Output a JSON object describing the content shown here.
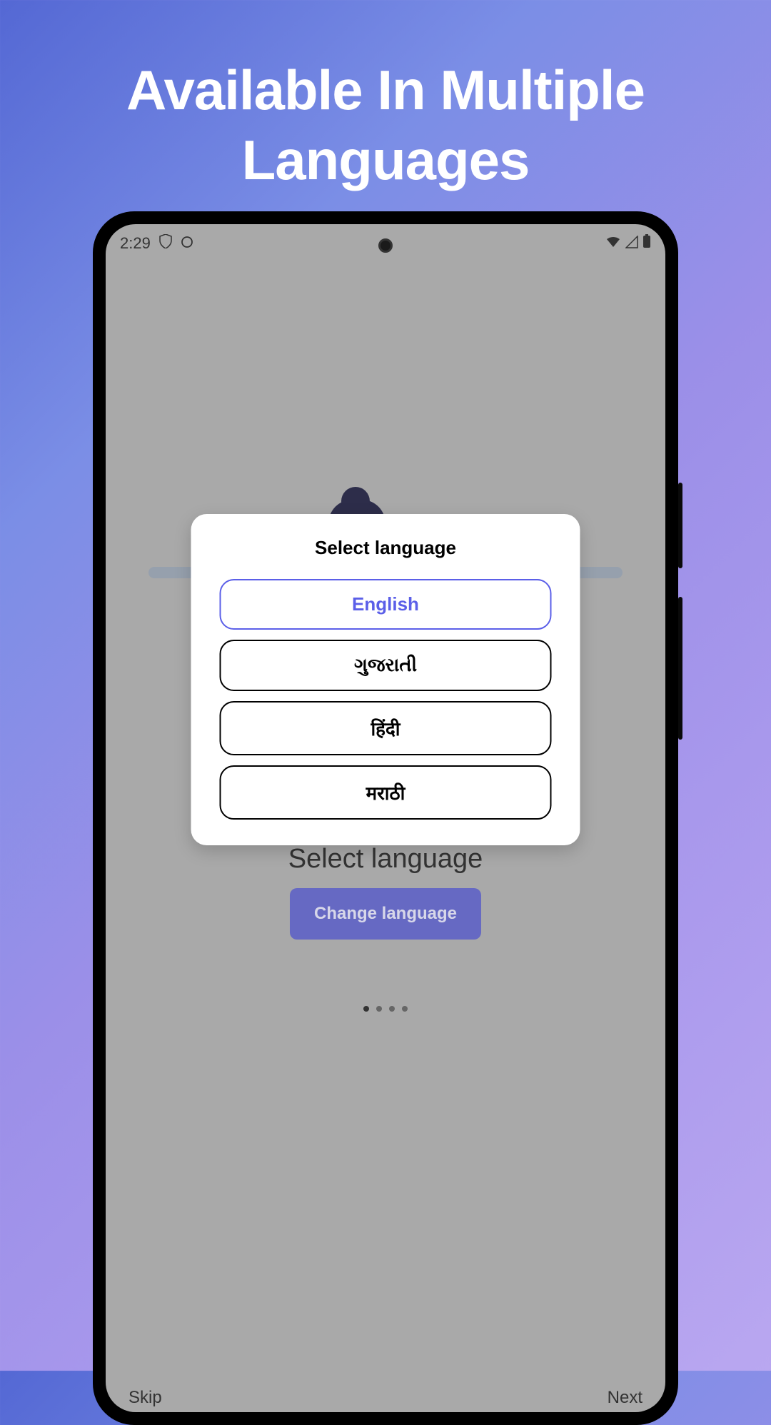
{
  "marketing": {
    "headline": "Available In Multiple Languages"
  },
  "statusbar": {
    "time": "2:29",
    "shield_icon": "shield",
    "circle_icon": "circle",
    "wifi_icon": "wifi",
    "signal_icon": "signal",
    "battery_icon": "battery"
  },
  "dialog": {
    "title": "Select language",
    "options": [
      {
        "label": "English",
        "selected": true
      },
      {
        "label": "ગુજરાતી",
        "selected": false
      },
      {
        "label": "हिंदी",
        "selected": false
      },
      {
        "label": "मराठी",
        "selected": false
      }
    ]
  },
  "background_screen": {
    "title": "Select language",
    "change_button": "Change language"
  },
  "bottom": {
    "skip": "Skip",
    "next": "Next"
  },
  "colors": {
    "accent": "#5b5fe8",
    "dialog_bg": "#ffffff"
  }
}
